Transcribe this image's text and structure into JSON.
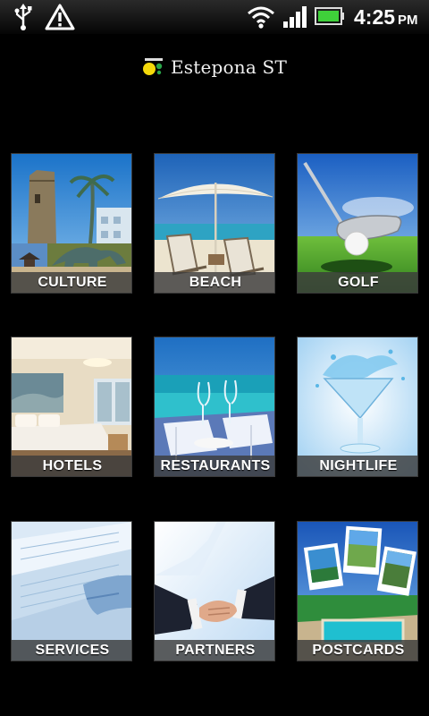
{
  "status_bar": {
    "time": "4:25",
    "ampm": "PM",
    "icons": [
      "usb-icon",
      "warning-icon",
      "wifi-icon",
      "signal-icon",
      "battery-icon"
    ],
    "battery_color": "#3fd13a"
  },
  "header": {
    "brand_name": "Estepona ST",
    "logo_small_text": "ESTEPONA",
    "logo_colors": [
      "#f4d90a",
      "#2aa64a"
    ]
  },
  "tiles": [
    {
      "label": "CULTURE"
    },
    {
      "label": "BEACH"
    },
    {
      "label": "GOLF"
    },
    {
      "label": "HOTELS"
    },
    {
      "label": "RESTAURANTS"
    },
    {
      "label": "NIGHTLIFE"
    },
    {
      "label": "SERVICES"
    },
    {
      "label": "PARTNERS"
    },
    {
      "label": "POSTCARDS"
    }
  ]
}
